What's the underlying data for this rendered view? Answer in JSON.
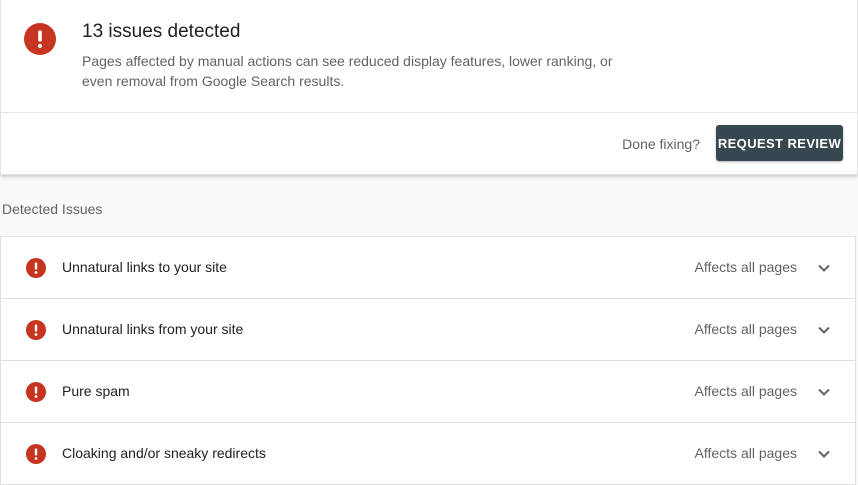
{
  "summary": {
    "title": "13 issues detected",
    "description": "Pages affected by manual actions can see reduced display features, lower ranking, or even removal from Google Search results.",
    "done_fixing_label": "Done fixing?",
    "request_review_label": "REQUEST REVIEW",
    "icon": "error-icon"
  },
  "detected_issues": {
    "heading": "Detected Issues",
    "items": [
      {
        "title": "Unnatural links to your site",
        "scope": "Affects all pages",
        "icon": "error-icon",
        "expand_icon": "chevron-down-icon"
      },
      {
        "title": "Unnatural links from your site",
        "scope": "Affects all pages",
        "icon": "error-icon",
        "expand_icon": "chevron-down-icon"
      },
      {
        "title": "Pure spam",
        "scope": "Affects all pages",
        "icon": "error-icon",
        "expand_icon": "chevron-down-icon"
      },
      {
        "title": "Cloaking and/or sneaky redirects",
        "scope": "Affects all pages",
        "icon": "error-icon",
        "expand_icon": "chevron-down-icon"
      }
    ]
  },
  "colors": {
    "error": "#c5351f",
    "button_bg": "#37474f",
    "secondary_text": "#5f6368",
    "primary_text": "#202124"
  }
}
